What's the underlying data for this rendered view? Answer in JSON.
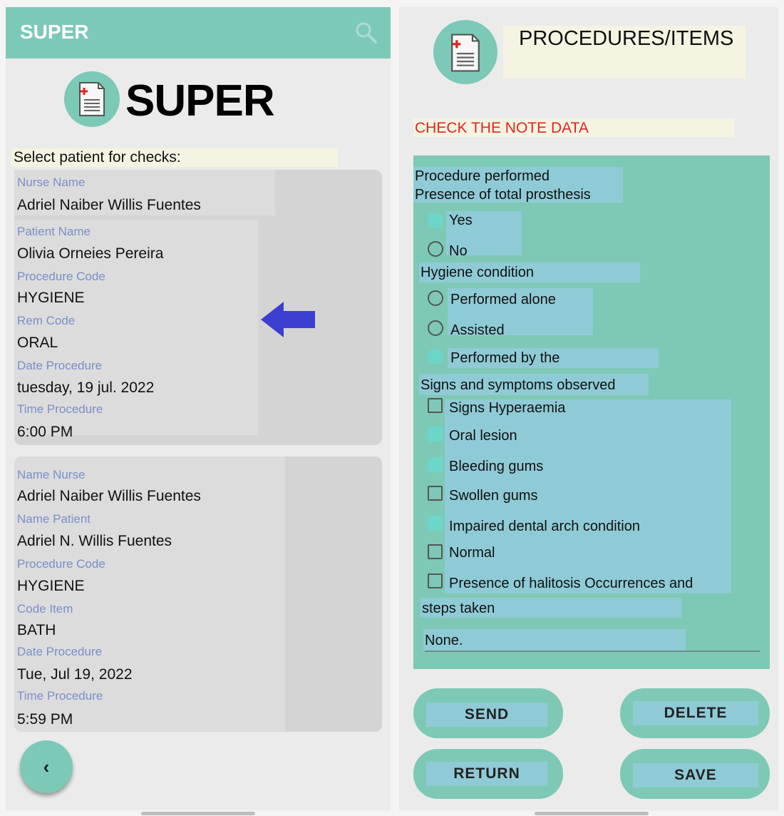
{
  "left": {
    "appbar_title": "SUPER",
    "logo_text": "SUPER",
    "select_label": "Select patient for checks:",
    "cards": [
      {
        "fields": [
          {
            "label": "Nurse Name",
            "value": "Adriel Naiber Willis Fuentes"
          },
          {
            "label": "Patient Name",
            "value": "Olivia Orneies Pereira"
          },
          {
            "label": "Procedure Code",
            "value": "HYGIENE"
          },
          {
            "label": "Rem Code",
            "value": "ORAL"
          },
          {
            "label": "Date Procedure",
            "value": "tuesday, 19 jul. 2022"
          },
          {
            "label": "Time Procedure",
            "value": "6:00 PM"
          }
        ]
      },
      {
        "fields": [
          {
            "label": "Name Nurse",
            "value": "Adriel Naiber Willis Fuentes"
          },
          {
            "label": "Name Patient",
            "value": "Adriel N. Willis Fuentes"
          },
          {
            "label": "Procedure Code",
            "value": "HYGIENE"
          },
          {
            "label": "Code Item",
            "value": "BATH"
          },
          {
            "label": "Date Procedure",
            "value": "Tue, Jul 19, 2022"
          },
          {
            "label": "Time Procedure",
            "value": "5:59 PM"
          }
        ]
      }
    ],
    "back_label": "‹"
  },
  "right": {
    "title": "PROCEDURES/ITEMS",
    "check_note": "CHECK THE NOTE DATA",
    "procedure_line1": "Procedure performed",
    "procedure_line2": "Presence of total prosthesis",
    "prosthesis_options": [
      {
        "label": "Yes",
        "selected": true
      },
      {
        "label": "No",
        "selected": false
      }
    ],
    "hygiene_label": "Hygiene condition",
    "hygiene_options": [
      {
        "label": "Performed alone",
        "selected": false
      },
      {
        "label": "Assisted",
        "selected": false
      },
      {
        "label": "Performed by the",
        "selected": true
      }
    ],
    "signs_label": "Signs and symptoms observed",
    "signs_options": [
      {
        "label": "Signs Hyperaemia",
        "checked": false
      },
      {
        "label": "Oral lesion",
        "checked": true
      },
      {
        "label": "Bleeding gums",
        "checked": true
      },
      {
        "label": "Swollen gums",
        "checked": false
      },
      {
        "label": "Impaired dental arch condition",
        "checked": true
      },
      {
        "label": "Normal",
        "checked": false
      },
      {
        "label": "Presence of halitosis Occurrences and",
        "checked": false
      }
    ],
    "steps_label": "steps taken",
    "steps_value": "None.",
    "buttons": {
      "send": "SEND",
      "delete": "DELETE",
      "return": "RETURN",
      "save": "SAVE"
    }
  },
  "colors": {
    "teal": "#7cc9b8",
    "highlight": "#8fcbd6",
    "label_blue": "#7a8fc9",
    "warning_red": "#e0261f",
    "arrow_blue": "#3b3fd0"
  }
}
